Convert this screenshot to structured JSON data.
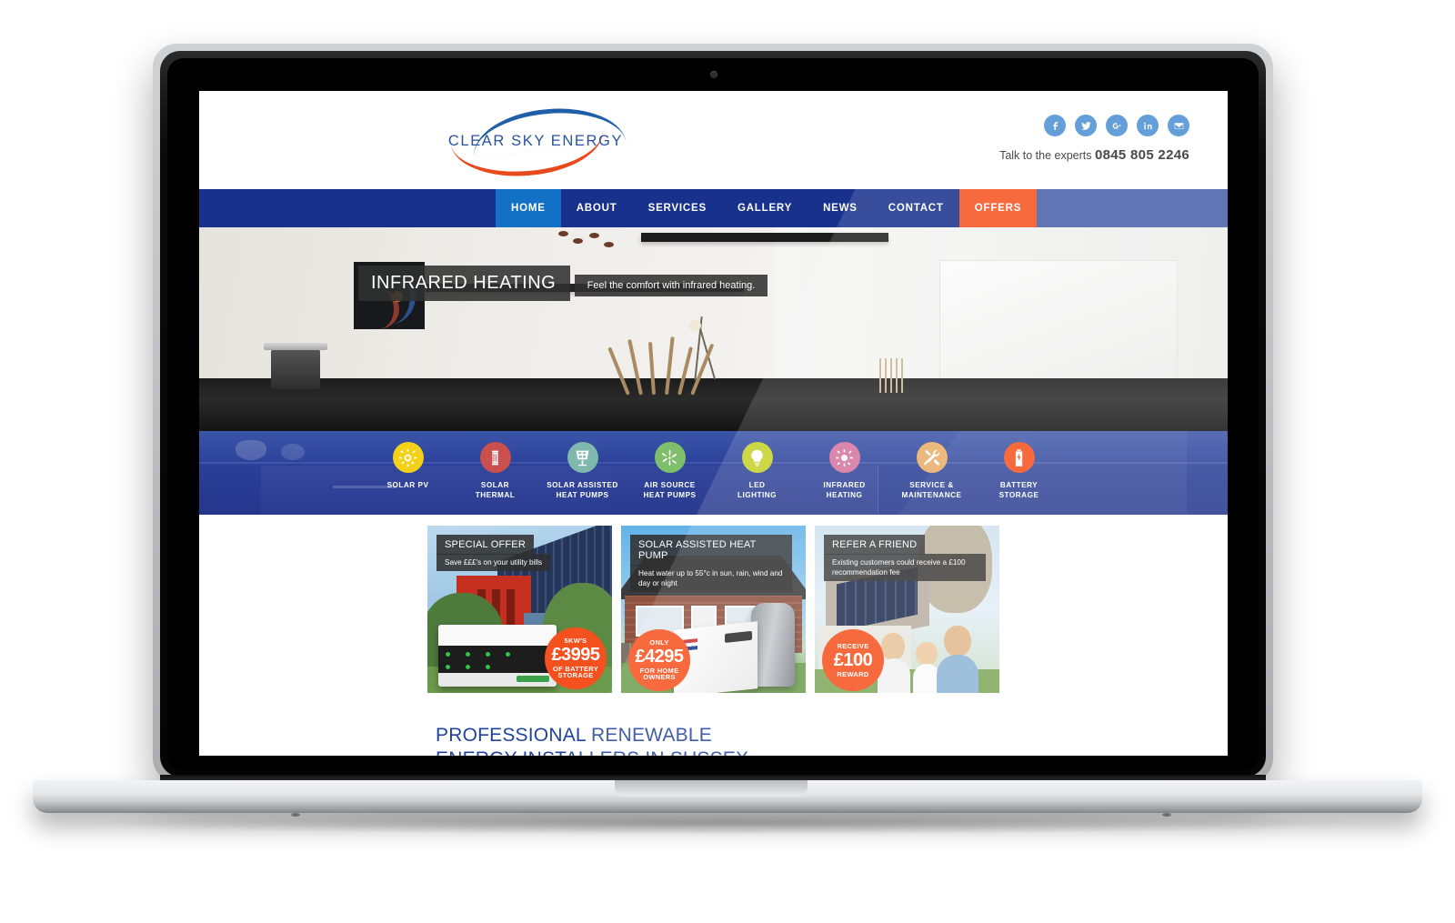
{
  "header": {
    "logo_text": "CLEAR SKY ENERGY",
    "social": [
      {
        "name": "facebook-icon",
        "glyph": "f"
      },
      {
        "name": "twitter-icon",
        "glyph": "t"
      },
      {
        "name": "google-plus-icon",
        "glyph": "g+"
      },
      {
        "name": "linkedin-icon",
        "glyph": "in"
      },
      {
        "name": "email-icon",
        "glyph": "mail"
      }
    ],
    "phone_lead": "Talk to the experts ",
    "phone_number": "0845 805 2246"
  },
  "nav": {
    "items": [
      {
        "label": "HOME",
        "state": "active"
      },
      {
        "label": "ABOUT",
        "state": "default"
      },
      {
        "label": "SERVICES",
        "state": "default"
      },
      {
        "label": "GALLERY",
        "state": "default"
      },
      {
        "label": "NEWS",
        "state": "default"
      },
      {
        "label": "CONTACT",
        "state": "default"
      },
      {
        "label": "OFFERS",
        "state": "offers"
      }
    ],
    "colors": {
      "bar": "#17318C",
      "active": "#1271C4",
      "offers": "#F4511E",
      "glare": "#475DA8"
    }
  },
  "hero": {
    "title": "INFRARED HEATING",
    "subtitle": "Feel the comfort with infrared heating."
  },
  "services": {
    "items": [
      {
        "label_line1": "SOLAR PV",
        "label_line2": "",
        "icon": "sun-icon",
        "color": "#F4D118"
      },
      {
        "label_line1": "SOLAR",
        "label_line2": "THERMAL",
        "icon": "thermal-cylinder-icon",
        "color": "#C9504C"
      },
      {
        "label_line1": "SOLAR ASSISTED",
        "label_line2": "HEAT PUMPS",
        "icon": "solar-panel-icon",
        "color": "#7FB8AD"
      },
      {
        "label_line1": "AIR SOURCE",
        "label_line2": "HEAT PUMPS",
        "icon": "fan-icon",
        "color": "#7EBF6B"
      },
      {
        "label_line1": "LED",
        "label_line2": "LIGHTING",
        "icon": "lightbulb-icon",
        "color": "#C5D22B"
      },
      {
        "label_line1": "INFRARED",
        "label_line2": "HEATING",
        "icon": "radiant-sun-icon",
        "color": "#D4739E"
      },
      {
        "label_line1": "SERVICE &",
        "label_line2": "MAINTENANCE",
        "icon": "tools-icon",
        "color": "#E8AE68"
      },
      {
        "label_line1": "BATTERY",
        "label_line2": "STORAGE",
        "icon": "battery-icon",
        "color": "#F4511E"
      }
    ]
  },
  "promos": [
    {
      "title": "SPECIAL OFFER",
      "subtitle": "Save £££'s on your utility bills",
      "badge_top": "5KW'S",
      "badge_price": "£3995",
      "badge_bottom": "OF BATTERY STORAGE"
    },
    {
      "title": "SOLAR ASSISTED HEAT PUMP",
      "subtitle": "Heat water up to 55°c in sun, rain, wind and day or night",
      "badge_top": "ONLY",
      "badge_price": "£4295",
      "badge_bottom": "FOR HOME OWNERS"
    },
    {
      "title": "REFER A FRIEND",
      "subtitle": "Existing customers could receive a £100 recommendation fee",
      "badge_top": "RECEIVE",
      "badge_price": "£100",
      "badge_bottom": "REWARD"
    }
  ],
  "bottom": {
    "heading_line1": "PROFESSIONAL RENEWABLE",
    "heading_line2": "ENERGY INSTALLERS IN SUSSEX,"
  }
}
